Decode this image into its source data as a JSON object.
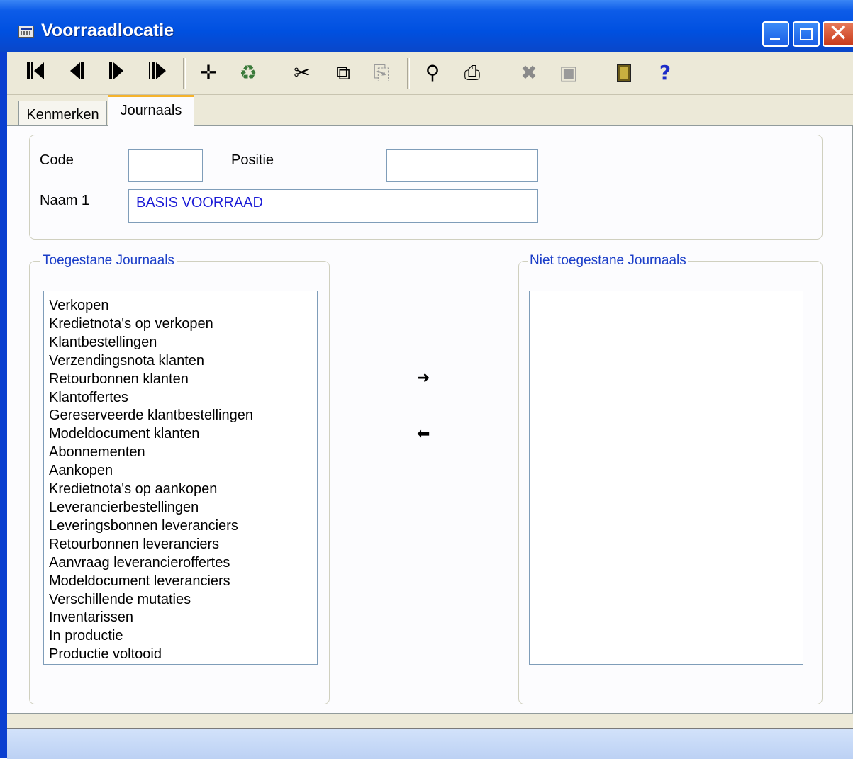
{
  "window": {
    "title": "Voorraadlocatie",
    "icon": "form-icon",
    "controls": [
      "minimize-icon",
      "maximize-icon",
      "close-icon"
    ]
  },
  "toolbar": {
    "buttons": [
      {
        "name": "first-record-icon",
        "label": "Eerste"
      },
      {
        "name": "previous-record-icon",
        "label": "Vorige"
      },
      {
        "name": "next-record-icon",
        "label": "Volgende"
      },
      {
        "name": "last-record-icon",
        "label": "Laatste"
      },
      {
        "name": "add-icon",
        "label": "Nieuw"
      },
      {
        "name": "recycle-icon",
        "label": "Herstellen"
      },
      {
        "name": "cut-icon",
        "label": "Knippen"
      },
      {
        "name": "copy-icon",
        "label": "Kopieren"
      },
      {
        "name": "paste-icon",
        "label": "Plakken"
      },
      {
        "name": "search-icon",
        "label": "Zoeken"
      },
      {
        "name": "print-icon",
        "label": "Afdrukken"
      },
      {
        "name": "delete-icon",
        "label": "Verwijderen"
      },
      {
        "name": "save-icon",
        "label": "Opslaan"
      },
      {
        "name": "exit-door-icon",
        "label": "Sluiten"
      },
      {
        "name": "help-icon",
        "label": "?"
      }
    ]
  },
  "tabs": [
    {
      "label": "Kenmerken",
      "active": false
    },
    {
      "label": "Journaals",
      "active": true
    }
  ],
  "form": {
    "code_label": "Code",
    "code_value": "",
    "positie_label": "Positie",
    "positie_value": "",
    "naam1_label": "Naam 1",
    "naam1_value": "BASIS VOORRAAD"
  },
  "allowed": {
    "title": "Toegestane Journaals",
    "items": [
      "Verkopen",
      "Kredietnota's op verkopen",
      "Klantbestellingen",
      "Verzendingsnota klanten",
      "Retourbonnen klanten",
      "Klantoffertes",
      "Gereserveerde klantbestellingen",
      "Modeldocument klanten",
      "Abonnementen",
      "Aankopen",
      "Kredietnota's op aankopen",
      "Leverancierbestellingen",
      "Leveringsbonnen leveranciers",
      "Retourbonnen leveranciers",
      "Aanvraag leverancieroffertes",
      "Modeldocument leveranciers",
      "Verschillende mutaties",
      "Inventarissen",
      "In productie",
      "Productie voltooid"
    ]
  },
  "not_allowed": {
    "title": "Niet toegestane Journaals",
    "items": []
  },
  "transfer": {
    "move_right": "➜",
    "move_left": "⬅"
  },
  "colors": {
    "titlebar": "#0050e0",
    "field_text": "#1b1bd6",
    "legend_text": "#1b3ec8",
    "active_tab_accent": "#f5b32c"
  }
}
